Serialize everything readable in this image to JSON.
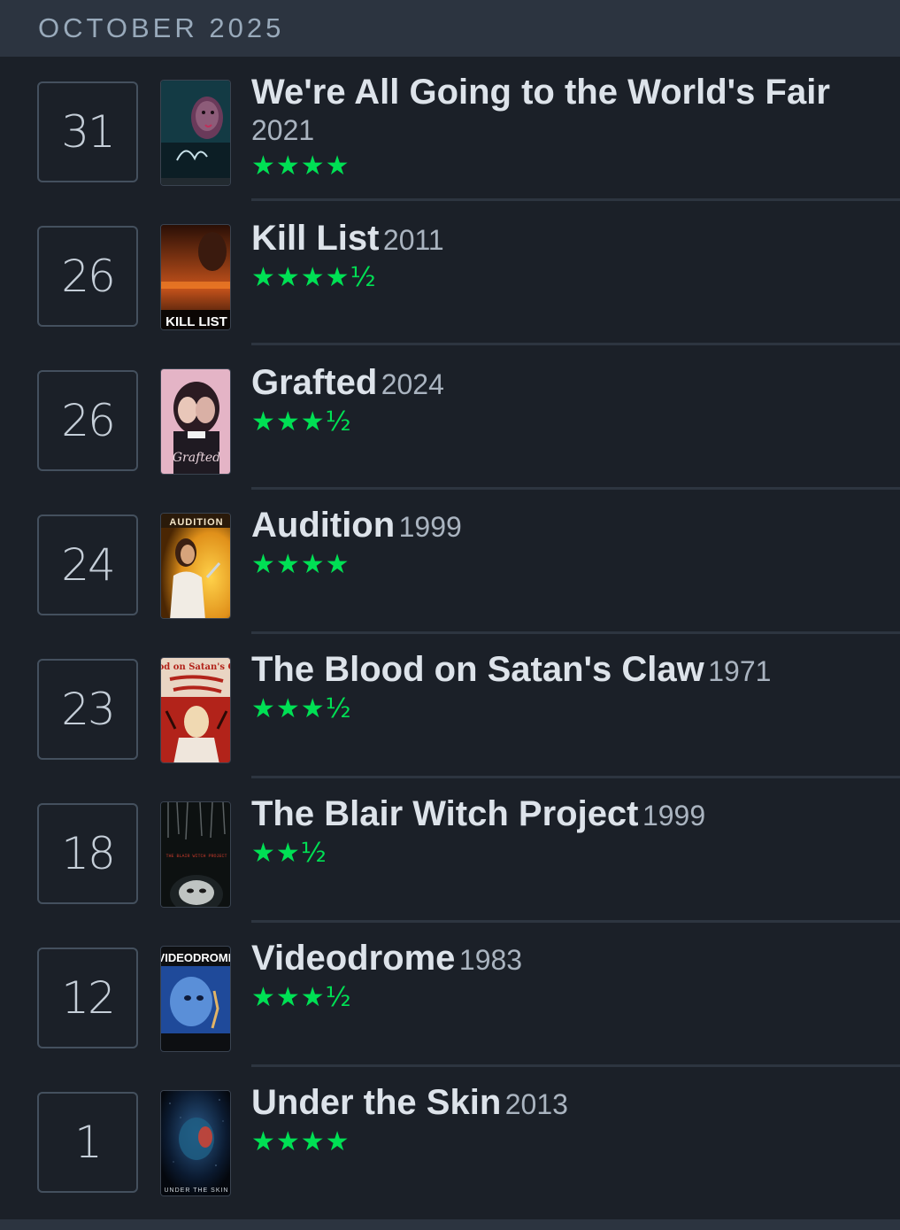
{
  "header": {
    "month": "OCTOBER 2025"
  },
  "entries": [
    {
      "day": "31",
      "title": "We're All Going to the World's Fair",
      "year": "2021",
      "stars": "★★★★",
      "poster_text": "",
      "poster_colors": [
        "#0d2a33",
        "#1e4a55"
      ],
      "poster_icon": "poster-worlds-fair-icon"
    },
    {
      "day": "26",
      "title": "Kill List",
      "year": "2011",
      "stars": "★★★★½",
      "poster_text": "KILL LIST",
      "poster_colors": [
        "#2a1208",
        "#c4521b"
      ],
      "poster_icon": "poster-kill-list-icon"
    },
    {
      "day": "26",
      "title": "Grafted",
      "year": "2024",
      "stars": "★★★½",
      "poster_text": "Grafted",
      "poster_colors": [
        "#e7b5c8",
        "#3b2330"
      ],
      "poster_icon": "poster-grafted-icon"
    },
    {
      "day": "24",
      "title": "Audition",
      "year": "1999",
      "stars": "★★★★",
      "poster_text": "AUDITION",
      "poster_colors": [
        "#f2b227",
        "#5a3205"
      ],
      "poster_icon": "poster-audition-icon"
    },
    {
      "day": "23",
      "title": "The Blood on Satan's Claw",
      "year": "1971",
      "stars": "★★★½",
      "poster_text": "Blood on Satan's Claw",
      "poster_colors": [
        "#c0241b",
        "#e8d3c1"
      ],
      "poster_icon": "poster-blood-satans-claw-icon"
    },
    {
      "day": "18",
      "title": "The Blair Witch Project",
      "year": "1999",
      "stars": "★★½",
      "poster_text": "THE BLAIR WITCH PROJECT",
      "poster_colors": [
        "#0c1010",
        "#4a4e50"
      ],
      "poster_icon": "poster-blair-witch-icon"
    },
    {
      "day": "12",
      "title": "Videodrome",
      "year": "1983",
      "stars": "★★★½",
      "poster_text": "VIDEODROME",
      "poster_colors": [
        "#1a3e8c",
        "#3f7fd0"
      ],
      "poster_icon": "poster-videodrome-icon"
    },
    {
      "day": "1",
      "title": "Under the Skin",
      "year": "2013",
      "stars": "★★★★",
      "poster_text": "UNDER THE SKIN",
      "poster_colors": [
        "#050a14",
        "#1c3e6a"
      ],
      "poster_icon": "poster-under-the-skin-icon"
    }
  ],
  "colors": {
    "background": "#1b2028",
    "header_bg": "#2c3440",
    "star_green": "#00e054",
    "title_text": "#dde3ea",
    "muted_text": "#aab4c0"
  }
}
